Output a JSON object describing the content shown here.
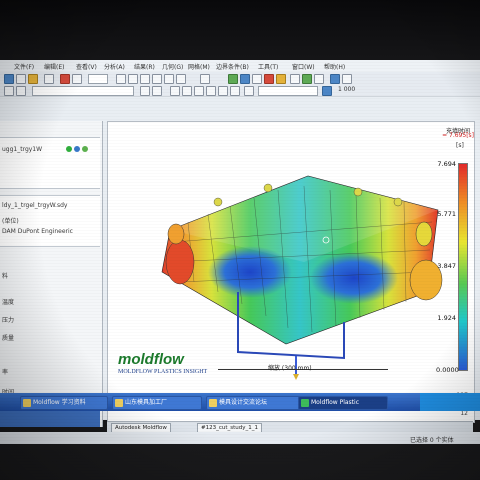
{
  "menu": {
    "items": [
      "文件(F)",
      "编辑(E)",
      "查看(V)",
      "分析(A)",
      "结果(R)",
      "几何(G)",
      "网格(M)",
      "边界条件(B)",
      "工具(T)",
      "窗口(W)",
      "帮助(H)"
    ]
  },
  "toolbar": {
    "mesh_count_label": "1 000"
  },
  "left_panel": {
    "project_item": "ugg1_trgy1W",
    "study_item": "ldy_1_trgel_trgyW.sdy",
    "material_item_a": "(单位)",
    "material_item_b": "DAM DuPont Engineeric",
    "item_c": "料",
    "item_d": "温度",
    "item_e": "压力",
    "item_f": "质量",
    "item_g": "率",
    "item_h": "时间"
  },
  "result_view": {
    "title": "充填时间",
    "subtitle": "= 7.695[s]",
    "unit": "[s]",
    "legend_ticks": [
      "7.694",
      "5.771",
      "3.847",
      "1.924",
      "0.0000"
    ],
    "scale_label": "缩放 (300 mm)",
    "corner_numbers": [
      "127",
      "187",
      "12"
    ],
    "brand": "moldflow",
    "brand_sub": "MOLDFLOW PLASTICS INSIGHT"
  },
  "doc_tabs": [
    "Autodesk Moldflow",
    "#123_cut_study_1_1"
  ],
  "statusbar": {
    "right_text": "已选择 0 个实体"
  },
  "taskbar": {
    "items": [
      "Moldflow 学习资料",
      "山东模具加工厂",
      "模具设计交流论坛",
      "Moldflow Plastic"
    ]
  },
  "colors": {
    "legend_top": "#e22a2a",
    "legend_bottom": "#2a5cd8",
    "brand": "#1c7a2c",
    "taskbar": "#2a5cbd"
  }
}
